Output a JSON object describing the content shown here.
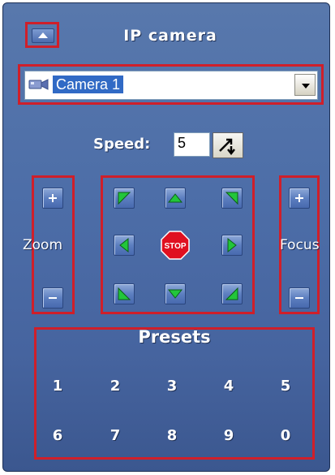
{
  "header": {
    "title": "IP camera",
    "collapse_icon": "collapse-up-icon"
  },
  "camera_select": {
    "selected": "Camera 1",
    "icon": "camera-icon"
  },
  "speed": {
    "label": "Speed:",
    "value": "5"
  },
  "zoom": {
    "label": "Zoom",
    "in": "+",
    "out": "−"
  },
  "focus": {
    "label": "Focus",
    "in": "+",
    "out": "−"
  },
  "ptz": {
    "stop_label": "STOP"
  },
  "presets": {
    "title": "Presets",
    "items": [
      "1",
      "2",
      "3",
      "4",
      "5",
      "6",
      "7",
      "8",
      "9",
      "0"
    ]
  },
  "colors": {
    "highlight_border": "#cf1f2a",
    "panel_top": "#5878ac",
    "panel_bottom": "#3b578f",
    "arrow_green": "#1fc33a",
    "stop_red": "#e01020"
  }
}
